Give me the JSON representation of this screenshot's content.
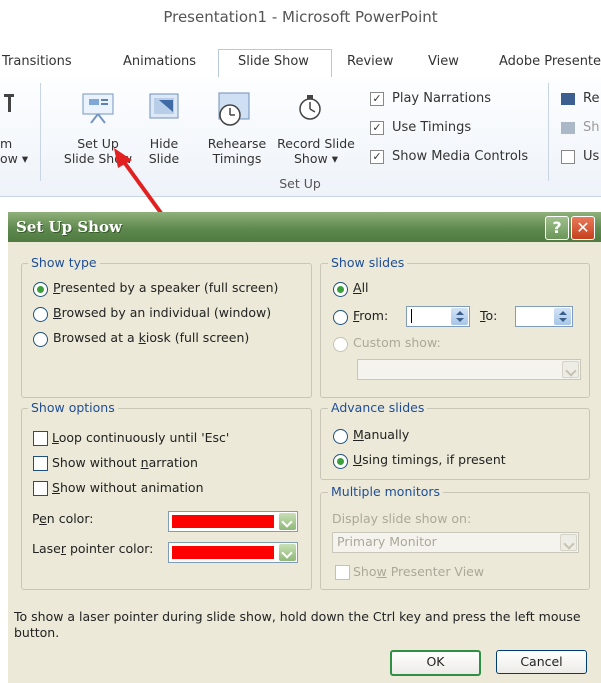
{
  "window_title": "Presentation1 - Microsoft PowerPoint",
  "tabs": [
    "Transitions",
    "Animations",
    "Slide Show",
    "Review",
    "View",
    "Adobe Presente"
  ],
  "active_tab": "Slide Show",
  "ribbon": {
    "cut_left_line1": "m",
    "cut_left_line2": "ow",
    "setup_line1": "Set Up",
    "setup_line2": "Slide Show",
    "hide_line1": "Hide",
    "hide_line2": "Slide",
    "rehearse_line1": "Rehearse",
    "rehearse_line2": "Timings",
    "record_line1": "Record Slide",
    "record_line2": "Show",
    "play_narrations": "Play Narrations",
    "use_timings": "Use Timings",
    "show_media_controls": "Show Media Controls",
    "group_label": "Set Up",
    "right_1": "Re",
    "right_2": "Sh",
    "right_3": "Us"
  },
  "dialog": {
    "title": "Set Up Show",
    "help_glyph": "?",
    "close_glyph": "✕",
    "show_type": {
      "legend": "Show type",
      "options": [
        "Presented by a speaker (full screen)",
        "Browsed by an individual (window)",
        "Browsed at a kiosk (full screen)"
      ],
      "selected_index": 0
    },
    "show_slides": {
      "legend": "Show slides",
      "all": "All",
      "from": "From:",
      "to": "To:",
      "from_value": "",
      "to_value": "",
      "custom_show": "Custom show:",
      "custom_value": ""
    },
    "show_options": {
      "legend": "Show options",
      "loop": "Loop continuously until 'Esc'",
      "no_narration": "Show without narration",
      "no_animation": "Show without animation",
      "pen_color_label": "Pen color:",
      "laser_color_label": "Laser pointer color:",
      "pen_color": "#ff0000",
      "laser_color": "#ff0000"
    },
    "advance_slides": {
      "legend": "Advance slides",
      "manually": "Manually",
      "using_timings": "Using timings, if present",
      "selected": "using_timings"
    },
    "multiple_monitors": {
      "legend": "Multiple monitors",
      "display_label": "Display slide show on:",
      "monitor_value": "Primary Monitor",
      "presenter_view": "Show Presenter View"
    },
    "hint_line1": "To show a laser pointer during slide show, hold down the Ctrl key and press the left mouse",
    "hint_line2": "button.",
    "ok": "OK",
    "cancel": "Cancel"
  },
  "colors": {
    "accent_blue": "#1f4e96",
    "titlebar_green": "#5f8a4f",
    "arrow_red": "#e32020"
  }
}
